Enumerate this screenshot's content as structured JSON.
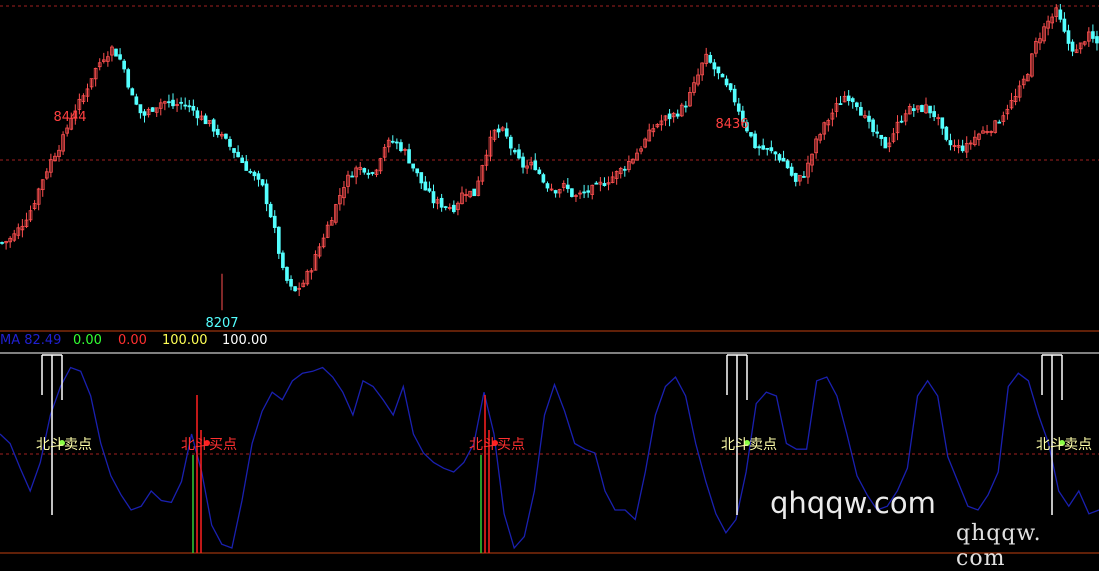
{
  "colors": {
    "background": "#000000",
    "candle_up": "#ff5050",
    "candle_down": "#54ffff",
    "grid": "#a02020",
    "divider": "#c04010",
    "osc_line": "#1a20b0",
    "peak_label": "#ff4040",
    "trough_label": "#54ffff",
    "sell_signal": "#ffffff",
    "buy_signal": "#ff2020",
    "sell_text": "#ffffaa",
    "buy_text": "#ff3030"
  },
  "indicator_header": {
    "ma": "MA 82.49",
    "v1": "0.00",
    "v2": "0.00",
    "v3": "100.00",
    "v4": "100.00",
    "ma_color": "#2020d0",
    "v1_color": "#33ff33",
    "v2_color": "#ff3030",
    "v3_color": "#ffff55",
    "v4_color": "#ffffff"
  },
  "signal_text": {
    "sell": "北斗卖点",
    "buy": "北斗买点"
  },
  "watermark": {
    "main": "qhqqw.com",
    "secondary": "qhqqw. com"
  },
  "chart_data": [
    {
      "type": "line",
      "subtype": "candlestick",
      "annotations": [
        {
          "label": "8444",
          "kind": "peak"
        },
        {
          "label": "8436",
          "kind": "peak"
        },
        {
          "label": "8207",
          "kind": "trough"
        }
      ],
      "price_range": [
        8200,
        8480
      ],
      "series": [
        {
          "values": [
            8268,
            8272,
            8285,
            8300,
            8325,
            8345,
            8360,
            8385,
            8398,
            8420,
            8435,
            8444,
            8430,
            8398,
            8382,
            8390,
            8396,
            8392,
            8394,
            8388,
            8380,
            8372,
            8362,
            8352,
            8340,
            8328,
            8317,
            8285,
            8240,
            8222,
            8232,
            8250,
            8274,
            8296,
            8320,
            8334,
            8336,
            8330,
            8355,
            8360,
            8352,
            8335,
            8318,
            8305,
            8302,
            8300,
            8315,
            8312,
            8346,
            8368,
            8368,
            8347,
            8336,
            8339,
            8322,
            8316,
            8319,
            8309,
            8313,
            8317,
            8323,
            8329,
            8337,
            8347,
            8360,
            8374,
            8380,
            8384,
            8392,
            8412,
            8436,
            8424,
            8410,
            8396,
            8374,
            8355,
            8352,
            8348,
            8340,
            8322,
            8332,
            8358,
            8376,
            8390,
            8402,
            8396,
            8378,
            8364,
            8355,
            8372,
            8388,
            8388,
            8390,
            8382,
            8358,
            8354,
            8354,
            8365,
            8370,
            8375,
            8390,
            8400,
            8420,
            8450,
            8466,
            8477,
            8450,
            8440,
            8456,
            8448
          ]
        }
      ]
    },
    {
      "type": "line",
      "ylim": [
        0,
        100
      ],
      "series": [
        {
          "values": [
            60,
            55,
            42,
            30,
            45,
            70,
            85,
            95,
            93,
            80,
            55,
            38,
            28,
            20,
            22,
            30,
            25,
            24,
            35,
            60,
            40,
            12,
            2,
            0,
            25,
            55,
            72,
            82,
            78,
            88,
            92,
            93,
            95,
            90,
            82,
            70,
            88,
            85,
            78,
            70,
            85,
            60,
            50,
            45,
            42,
            40,
            45,
            55,
            82,
            60,
            18,
            0,
            6,
            30,
            70,
            86,
            72,
            55,
            52,
            50,
            30,
            20,
            20,
            15,
            40,
            70,
            85,
            90,
            80,
            55,
            35,
            18,
            8,
            15,
            40,
            76,
            82,
            80,
            55,
            52,
            52,
            88,
            90,
            80,
            60,
            38,
            28,
            20,
            22,
            30,
            42,
            80,
            88,
            80,
            48,
            35,
            22,
            20,
            28,
            40,
            85,
            92,
            88,
            70,
            55,
            30,
            22,
            30,
            18,
            20
          ]
        }
      ],
      "threshold_line": 50,
      "signals": [
        {
          "type": "sell",
          "index": 12
        },
        {
          "type": "buy",
          "index": 37
        },
        {
          "type": "buy",
          "index": 83
        },
        {
          "type": "sell",
          "index": 150
        },
        {
          "type": "sell",
          "index": 213
        }
      ]
    }
  ]
}
